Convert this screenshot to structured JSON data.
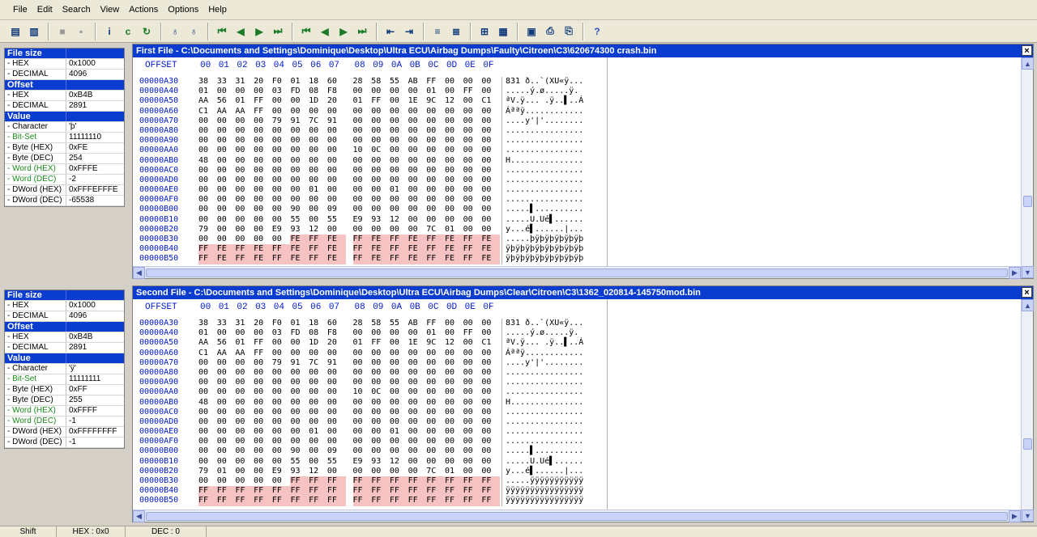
{
  "menu": [
    "File",
    "Edit",
    "Search",
    "View",
    "Actions",
    "Options",
    "Help"
  ],
  "toolbar": {
    "groups": [
      [
        {
          "name": "open-file-icon",
          "glyph": "▤"
        },
        {
          "name": "open-folder-icon",
          "glyph": "▥"
        }
      ],
      [
        {
          "name": "stop-icon",
          "glyph": "■",
          "cls": "dim"
        },
        {
          "name": "page-icon",
          "glyph": "▪",
          "cls": "dim"
        }
      ],
      [
        {
          "name": "info-icon",
          "glyph": "i"
        },
        {
          "name": "compare-icon",
          "glyph": "c",
          "cls": "green"
        },
        {
          "name": "refresh-icon",
          "glyph": "↻",
          "cls": "green"
        }
      ],
      [
        {
          "name": "binoculars-icon",
          "glyph": "♁"
        },
        {
          "name": "binoculars-next-icon",
          "glyph": "♁"
        }
      ],
      [
        {
          "name": "first-difference-icon",
          "glyph": "⏮",
          "cls": "green"
        },
        {
          "name": "previous-difference-icon",
          "glyph": "◀",
          "cls": "green"
        },
        {
          "name": "next-difference-icon",
          "glyph": "▶",
          "cls": "green"
        },
        {
          "name": "last-difference-icon",
          "glyph": "⏭",
          "cls": "green"
        }
      ],
      [
        {
          "name": "first-block-icon",
          "glyph": "⏮",
          "cls": "green"
        },
        {
          "name": "previous-block-icon",
          "glyph": "◀",
          "cls": "green"
        },
        {
          "name": "next-block-icon",
          "glyph": "▶",
          "cls": "green"
        },
        {
          "name": "last-block-icon",
          "glyph": "⏭",
          "cls": "green"
        }
      ],
      [
        {
          "name": "sync-left-icon",
          "glyph": "⇤"
        },
        {
          "name": "sync-right-icon",
          "glyph": "⇥"
        }
      ],
      [
        {
          "name": "align-left-icon",
          "glyph": "≡"
        },
        {
          "name": "align-right-icon",
          "glyph": "≣"
        }
      ],
      [
        {
          "name": "fit-width-icon",
          "glyph": "⊞"
        },
        {
          "name": "columns-icon",
          "glyph": "▦"
        }
      ],
      [
        {
          "name": "report-icon",
          "glyph": "▣"
        },
        {
          "name": "print-icon",
          "glyph": "⎙"
        },
        {
          "name": "print-preview-icon",
          "glyph": "⎘"
        }
      ],
      [
        {
          "name": "help-icon",
          "glyph": "?",
          "cls": "blue"
        }
      ]
    ]
  },
  "info_top": [
    {
      "head": true,
      "k": "File size",
      "v": ""
    },
    {
      "k": " - HEX",
      "v": "0x1000"
    },
    {
      "k": " - DECIMAL",
      "v": "4096"
    },
    {
      "head": true,
      "k": "Offset",
      "v": ""
    },
    {
      "k": " - HEX",
      "v": "0xB4B"
    },
    {
      "k": " - DECIMAL",
      "v": "2891"
    },
    {
      "head": true,
      "k": "Value",
      "v": ""
    },
    {
      "k": " - Character",
      "v": "'þ'"
    },
    {
      "k": " - Bit-Set",
      "v": "11111110",
      "g": true
    },
    {
      "k": " - Byte (HEX)",
      "v": "0xFE"
    },
    {
      "k": " - Byte (DEC)",
      "v": "254"
    },
    {
      "k": " - Word (HEX)",
      "v": "0xFFFE",
      "g": true
    },
    {
      "k": " - Word (DEC)",
      "v": "-2",
      "g": true
    },
    {
      "k": " - DWord (HEX)",
      "v": "0xFFFEFFFE"
    },
    {
      "k": " - DWord (DEC)",
      "v": "-65538"
    }
  ],
  "info_bottom": [
    {
      "head": true,
      "k": "File size",
      "v": ""
    },
    {
      "k": " - HEX",
      "v": "0x1000"
    },
    {
      "k": " - DECIMAL",
      "v": "4096"
    },
    {
      "head": true,
      "k": "Offset",
      "v": ""
    },
    {
      "k": " - HEX",
      "v": "0xB4B"
    },
    {
      "k": " - DECIMAL",
      "v": "2891"
    },
    {
      "head": true,
      "k": "Value",
      "v": ""
    },
    {
      "k": " - Character",
      "v": "'ÿ'"
    },
    {
      "k": " - Bit-Set",
      "v": "11111111",
      "g": true
    },
    {
      "k": " - Byte (HEX)",
      "v": "0xFF"
    },
    {
      "k": " - Byte (DEC)",
      "v": "255"
    },
    {
      "k": " - Word (HEX)",
      "v": "0xFFFF",
      "g": true
    },
    {
      "k": " - Word (DEC)",
      "v": "-1",
      "g": true
    },
    {
      "k": " - DWord (HEX)",
      "v": "0xFFFFFFFF"
    },
    {
      "k": " - DWord (DEC)",
      "v": "-1"
    }
  ],
  "offset_label": "OFFSET",
  "hex_columns": [
    "00",
    "01",
    "02",
    "03",
    "04",
    "05",
    "06",
    "07",
    "08",
    "09",
    "0A",
    "0B",
    "0C",
    "0D",
    "0E",
    "0F"
  ],
  "first_file": {
    "title": "First File - C:\\Documents and Settings\\Dominique\\Desktop\\Ultra ECU\\Airbag Dumps\\Faulty\\Citroen\\C3\\620674300 crash.bin",
    "rows": [
      {
        "off": "00000A30",
        "bytes": "38 33 31 20 F0 01 18 60 28 58 55 AB FF 00 00 00",
        "ascii": "831 ð..`(XU«ÿ..."
      },
      {
        "off": "00000A40",
        "bytes": "01 00 00 00 03 FD 08 F8 00 00 00 00 01 00 FF 00",
        "ascii": ".....ý.ø.....ÿ."
      },
      {
        "off": "00000A50",
        "bytes": "AA 56 01 FF 00 00 1D 20 01 FF 00 1E 9C 12 00 C1",
        "ascii": "ªV.ÿ... .ÿ..▌..Á"
      },
      {
        "off": "00000A60",
        "bytes": "C1 AA AA FF 00 00 00 00 00 00 00 00 00 00 00 00",
        "ascii": "Áªªÿ............"
      },
      {
        "off": "00000A70",
        "bytes": "00 00 00 00 79 91 7C 91 00 00 00 00 00 00 00 00",
        "ascii": "....y'|'........"
      },
      {
        "off": "00000A80",
        "bytes": "00 00 00 00 00 00 00 00 00 00 00 00 00 00 00 00",
        "ascii": "................"
      },
      {
        "off": "00000A90",
        "bytes": "00 00 00 00 00 00 00 00 00 00 00 00 00 00 00 00",
        "ascii": "................"
      },
      {
        "off": "00000AA0",
        "bytes": "00 00 00 00 00 00 00 00 10 0C 00 00 00 00 00 00",
        "ascii": "................"
      },
      {
        "off": "00000AB0",
        "bytes": "48 00 00 00 00 00 00 00 00 00 00 00 00 00 00 00",
        "ascii": "H..............."
      },
      {
        "off": "00000AC0",
        "bytes": "00 00 00 00 00 00 00 00 00 00 00 00 00 00 00 00",
        "ascii": "................"
      },
      {
        "off": "00000AD0",
        "bytes": "00 00 00 00 00 00 00 00 00 00 00 00 00 00 00 00",
        "ascii": "................"
      },
      {
        "off": "00000AE0",
        "bytes": "00 00 00 00 00 00 01 00 00 00 01 00 00 00 00 00",
        "ascii": "................"
      },
      {
        "off": "00000AF0",
        "bytes": "00 00 00 00 00 00 00 00 00 00 00 00 00 00 00 00",
        "ascii": "................"
      },
      {
        "off": "00000B00",
        "bytes": "00 00 00 00 00 90 00 09 00 00 00 00 00 00 00 00",
        "ascii": ".....▌.........."
      },
      {
        "off": "00000B10",
        "bytes": "00 00 00 00 00 55 00 55 E9 93 12 00 00 00 00 00",
        "ascii": ".....U.Ué▌......"
      },
      {
        "off": "00000B20",
        "bytes": "79 00 00 00 E9 93 12 00 00 00 00 00 7C 01 00 00",
        "ascii": "y...é▌......|..."
      },
      {
        "off": "00000B30",
        "bytes": "00 00 00 00 00 FE FF FE FF FE FF FE FF FE FF FE",
        "ascii": ".....þÿþÿþÿþÿþÿþ",
        "diff": [
          5,
          6,
          7,
          8,
          9,
          10,
          11,
          12,
          13,
          14,
          15
        ]
      },
      {
        "off": "00000B40",
        "bytes": "FF FE FF FE FF FE FF FE FF FE FF FE FF FE FF FE",
        "ascii": "ÿþÿþÿþÿþÿþÿþÿþÿþ",
        "diff": [
          0,
          1,
          2,
          3,
          4,
          5,
          6,
          7,
          8,
          9,
          10,
          11,
          12,
          13,
          14,
          15
        ]
      },
      {
        "off": "00000B50",
        "bytes": "FF FE FF FE FF FE FF FE FF FE FF FE FF FE FF FE",
        "ascii": "ÿþÿþÿþÿþÿþÿþÿþÿþ",
        "diff": [
          0,
          1,
          2,
          3,
          4,
          5,
          6,
          7,
          8,
          9,
          10,
          11,
          12,
          13,
          14,
          15
        ]
      }
    ]
  },
  "second_file": {
    "title": "Second File - C:\\Documents and Settings\\Dominique\\Desktop\\Ultra ECU\\Airbag Dumps\\Clear\\Citroen\\C3\\1362_020814-145750mod.bin",
    "rows": [
      {
        "off": "00000A30",
        "bytes": "38 33 31 20 F0 01 18 60 28 58 55 AB FF 00 00 00",
        "ascii": "831 ð..`(XU«ÿ..."
      },
      {
        "off": "00000A40",
        "bytes": "01 00 00 00 03 FD 08 F8 00 00 00 00 01 00 FF 00",
        "ascii": ".....ý.ø.....ÿ."
      },
      {
        "off": "00000A50",
        "bytes": "AA 56 01 FF 00 00 1D 20 01 FF 00 1E 9C 12 00 C1",
        "ascii": "ªV.ÿ... .ÿ..▌..Á"
      },
      {
        "off": "00000A60",
        "bytes": "C1 AA AA FF 00 00 00 00 00 00 00 00 00 00 00 00",
        "ascii": "Áªªÿ............"
      },
      {
        "off": "00000A70",
        "bytes": "00 00 00 00 79 91 7C 91 00 00 00 00 00 00 00 00",
        "ascii": "....y'|'........"
      },
      {
        "off": "00000A80",
        "bytes": "00 00 00 00 00 00 00 00 00 00 00 00 00 00 00 00",
        "ascii": "................"
      },
      {
        "off": "00000A90",
        "bytes": "00 00 00 00 00 00 00 00 00 00 00 00 00 00 00 00",
        "ascii": "................"
      },
      {
        "off": "00000AA0",
        "bytes": "00 00 00 00 00 00 00 00 10 0C 00 00 00 00 00 00",
        "ascii": "................"
      },
      {
        "off": "00000AB0",
        "bytes": "48 00 00 00 00 00 00 00 00 00 00 00 00 00 00 00",
        "ascii": "H..............."
      },
      {
        "off": "00000AC0",
        "bytes": "00 00 00 00 00 00 00 00 00 00 00 00 00 00 00 00",
        "ascii": "................"
      },
      {
        "off": "00000AD0",
        "bytes": "00 00 00 00 00 00 00 00 00 00 00 00 00 00 00 00",
        "ascii": "................"
      },
      {
        "off": "00000AE0",
        "bytes": "00 00 00 00 00 00 01 00 00 00 01 00 00 00 00 00",
        "ascii": "................"
      },
      {
        "off": "00000AF0",
        "bytes": "00 00 00 00 00 00 00 00 00 00 00 00 00 00 00 00",
        "ascii": "................"
      },
      {
        "off": "00000B00",
        "bytes": "00 00 00 00 00 90 00 09 00 00 00 00 00 00 00 00",
        "ascii": ".....▌.........."
      },
      {
        "off": "00000B10",
        "bytes": "00 00 00 00 00 55 00 55 E9 93 12 00 00 00 00 00",
        "ascii": ".....U.Ué▌......"
      },
      {
        "off": "00000B20",
        "bytes": "79 01 00 00 E9 93 12 00 00 00 00 00 7C 01 00 00",
        "ascii": "y...é▌......|..."
      },
      {
        "off": "00000B30",
        "bytes": "00 00 00 00 00 FF FF FF FF FF FF FF FF FF FF FF",
        "ascii": ".....ÿÿÿÿÿÿÿÿÿÿÿ",
        "diff": [
          5,
          6,
          7,
          8,
          9,
          10,
          11,
          12,
          13,
          14,
          15
        ]
      },
      {
        "off": "00000B40",
        "bytes": "FF FF FF FF FF FF FF FF FF FF FF FF FF FF FF FF",
        "ascii": "ÿÿÿÿÿÿÿÿÿÿÿÿÿÿÿÿ",
        "diff": [
          0,
          1,
          2,
          3,
          4,
          5,
          6,
          7,
          8,
          9,
          10,
          11,
          12,
          13,
          14,
          15
        ]
      },
      {
        "off": "00000B50",
        "bytes": "FF FF FF FF FF FF FF FF FF FF FF FF FF FF FF FF",
        "ascii": "ÿÿÿÿÿÿÿÿÿÿÿÿÿÿÿÿ",
        "diff": [
          0,
          1,
          2,
          3,
          4,
          5,
          6,
          7,
          8,
          9,
          10,
          11,
          12,
          13,
          14,
          15
        ]
      }
    ]
  },
  "status": {
    "mode": "Shift",
    "hex": "HEX : 0x0",
    "dec": "DEC : 0"
  }
}
